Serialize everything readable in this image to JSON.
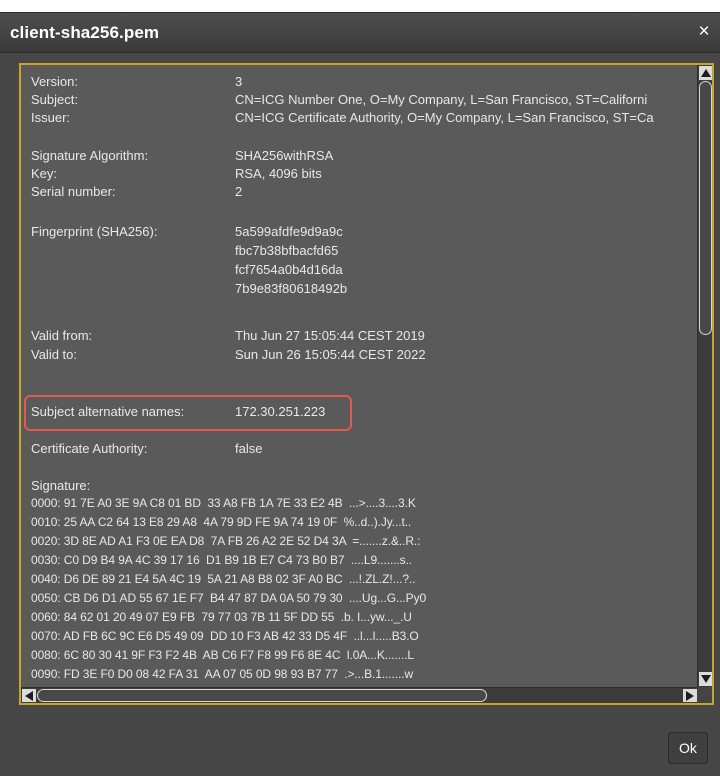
{
  "dialog": {
    "title": "client-sha256.pem",
    "close_glyph": "×",
    "ok_label": "Ok"
  },
  "certificate": {
    "version_label": "Version:",
    "version": "3",
    "subject_label": "Subject:",
    "subject": "CN=ICG Number One, O=My Company, L=San Francisco, ST=Californi",
    "issuer_label": "Issuer:",
    "issuer": "CN=ICG Certificate Authority, O=My Company, L=San Francisco, ST=Ca",
    "sig_alg_label": "Signature Algorithm:",
    "sig_alg": "SHA256withRSA",
    "key_label": "Key:",
    "key": "RSA, 4096 bits",
    "serial_label": "Serial number:",
    "serial": "2",
    "fingerprint_label": "Fingerprint (SHA256):",
    "fingerprint": [
      "5a599afdfe9d9a9c",
      "fbc7b38bfbacfd65",
      "fcf7654a0b4d16da",
      "7b9e83f80618492b"
    ],
    "valid_from_label": "Valid from:",
    "valid_from": "Thu Jun 27 15:05:44 CEST 2019",
    "valid_to_label": "Valid to:",
    "valid_to": "Sun Jun 26 15:05:44 CEST 2022",
    "san_label": "Subject alternative names:",
    "san": "172.30.251.223",
    "ca_label": "Certificate Authority:",
    "ca": "false",
    "signature_label": "Signature:",
    "signature_lines": [
      "0000: 91 7E A0 3E 9A C8 01 BD  33 A8 FB 1A 7E 33 E2 4B  ...>....3....3.K",
      "0010: 25 AA C2 64 13 E8 29 A8  4A 79 9D FE 9A 74 19 0F  %..d..).Jy...t..",
      "0020: 3D 8E AD A1 F3 0E EA D8  7A FB 26 A2 2E 52 D4 3A  =.......z.&..R.:",
      "0030: C0 D9 B4 9A 4C 39 17 16  D1 B9 1B E7 C4 73 B0 B7  ....L9.......s..",
      "0040: D6 DE 89 21 E4 5A 4C 19  5A 21 A8 B8 02 3F A0 BC  ...!.ZL.Z!...?..",
      "0050: CB D6 D1 AD 55 67 1E F7  B4 47 87 DA 0A 50 79 30  ....Ug...G...Py0",
      "0060: 84 62 01 20 49 07 E9 FB  79 77 03 7B 11 5F DD 55  .b. I...yw..._.U",
      "0070: AD FB 6C 9C E6 D5 49 09  DD 10 F3 AB 42 33 D5 4F  ..l...I.....B3.O",
      "0080: 6C 80 30 41 9F F3 F2 4B  AB C6 F7 F8 99 F6 8E 4C  l.0A...K.......L",
      "0090: FD 3E F0 D0 08 42 FA 31  AA 07 05 0D 98 93 B7 77  .>...B.1.......w"
    ]
  },
  "colors": {
    "panel_border": "#c8a52c",
    "highlight": "#e05a4e",
    "background": "#474747"
  }
}
